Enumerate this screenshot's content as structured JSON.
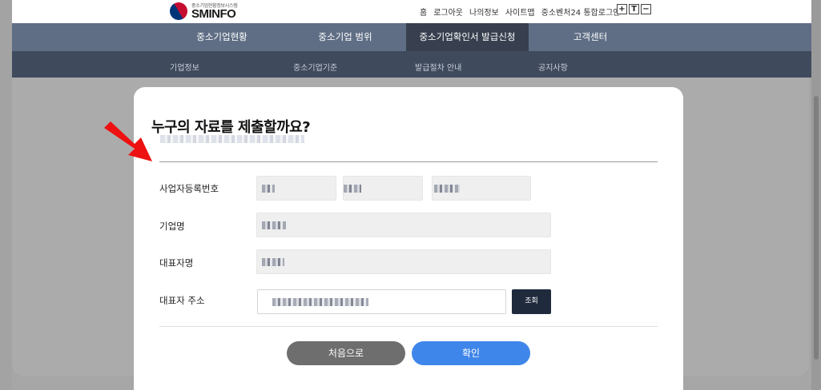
{
  "header": {
    "logo_sub": "중소기업현황정보시스템",
    "logo_main": "SMINFO",
    "util_links": [
      "홈",
      "로그아웃",
      "나의정보",
      "사이트맵",
      "중소벤처24 통합로그인"
    ],
    "font_buttons": [
      "+",
      "T",
      "−"
    ]
  },
  "nav": {
    "main": [
      {
        "label": "중소기업현황",
        "active": false
      },
      {
        "label": "중소기업 범위",
        "active": false
      },
      {
        "label": "중소기업확인서 발급신청",
        "active": true
      },
      {
        "label": "고객센터",
        "active": false
      }
    ],
    "sub": [
      "기업정보",
      "중소기업기준",
      "발급절차 안내",
      "공지사항"
    ]
  },
  "modal": {
    "title": "누구의 자료를 제출할까요?",
    "fields": {
      "biz_no_label": "사업자등록번호",
      "company_label": "기업명",
      "ceo_label": "대표자명",
      "address_label": "대표자 주소"
    },
    "search_button": "조회",
    "reset_button": "처음으로",
    "confirm_button": "확인"
  },
  "colors": {
    "nav_bg": "#5f6e85",
    "nav_active": "#38404f",
    "subnav_bg": "#3f4a5d",
    "confirm": "#3f86ea",
    "reset": "#6e6e6e",
    "arrow": "#ee1111"
  },
  "icons": {
    "logo": "taegeuk-logo-icon",
    "annotation": "red-arrow-icon"
  }
}
